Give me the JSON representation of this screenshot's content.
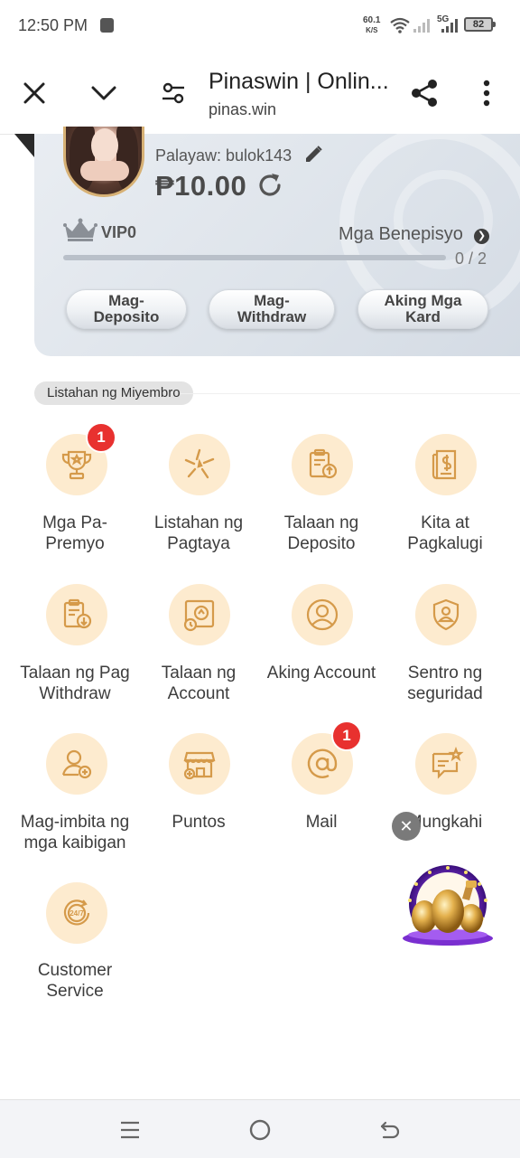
{
  "status_bar": {
    "time": "12:50 PM",
    "net_speed_top": "60.1",
    "net_speed_unit": "K/S",
    "network_label": "5G",
    "battery": "82"
  },
  "browser": {
    "title": "Pinaswin | Onlin...",
    "url": "pinas.win",
    "icons": [
      "close-icon",
      "chevron-down-icon",
      "tune-icon",
      "share-icon",
      "more-vert-icon"
    ]
  },
  "profile": {
    "nickname": "Palayaw: bulok143",
    "balance": "₱10.00",
    "vip_label": "VIP0",
    "benefits_label": "Mga Benepisyo",
    "progress_text": "0 / 2",
    "progress_fraction": 0.0,
    "buttons": [
      {
        "label": "Mag-\nDeposito"
      },
      {
        "label": "Mag-\nWithdraw"
      },
      {
        "label": "Aking Mga\nKard"
      }
    ]
  },
  "section": {
    "title": "Listahan ng Miyembro"
  },
  "menu": [
    {
      "label": "Mga Pa-\nPremyo",
      "icon": "trophy-icon",
      "badge": "1"
    },
    {
      "label": "Listahan ng\nPagtaya",
      "icon": "star-burst-icon",
      "badge": ""
    },
    {
      "label": "Talaan ng\nDeposito",
      "icon": "deposit-record-icon",
      "badge": ""
    },
    {
      "label": "Kita at\nPagkalugi",
      "icon": "profit-loss-icon",
      "badge": ""
    },
    {
      "label": "Talaan ng Pag\nWithdraw",
      "icon": "withdraw-record-icon",
      "badge": ""
    },
    {
      "label": "Talaan ng\nAccount",
      "icon": "account-record-icon",
      "badge": ""
    },
    {
      "label": "Aking Account",
      "icon": "user-circle-icon",
      "badge": ""
    },
    {
      "label": "Sentro ng\nseguridad",
      "icon": "shield-user-icon",
      "badge": ""
    },
    {
      "label": "Mag-imbita ng\nmga kaibigan",
      "icon": "invite-user-icon",
      "badge": ""
    },
    {
      "label": "Puntos",
      "icon": "shop-icon",
      "badge": ""
    },
    {
      "label": "Mail",
      "icon": "at-sign-icon",
      "badge": "1"
    },
    {
      "label": "Mungkahi",
      "icon": "feedback-icon",
      "badge": ""
    },
    {
      "label": "Customer\nService",
      "icon": "support-24-7-icon",
      "badge": ""
    }
  ],
  "colors": {
    "accent_gold": "#d9a55a",
    "icon_circle": "#fdebcf",
    "badge_red": "#e8312f",
    "card_bg": "#e2e7ee"
  }
}
